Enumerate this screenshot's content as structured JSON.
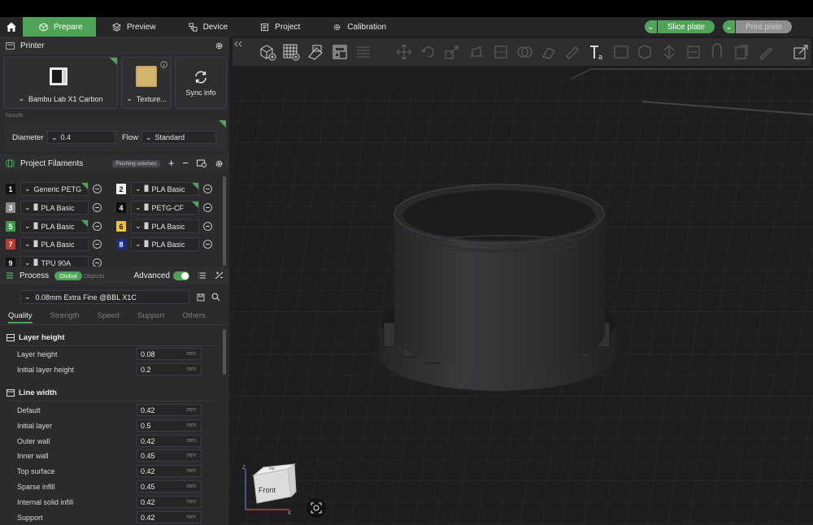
{
  "nav": {
    "tabs": [
      {
        "label": "Prepare"
      },
      {
        "label": "Preview"
      },
      {
        "label": "Device"
      },
      {
        "label": "Project"
      },
      {
        "label": "Calibration"
      }
    ],
    "slice_label": "Slice plate",
    "print_label": "Print plate"
  },
  "printer": {
    "section_title": "Printer",
    "name": "Bambu Lab X1 Carbon",
    "plate": "Texture...",
    "sync_label": "Sync info",
    "nozzle_title": "Nozzle",
    "diameter_label": "Diameter",
    "diameter_value": "0.4",
    "flow_label": "Flow",
    "flow_value": "Standard"
  },
  "filaments": {
    "section_title": "Project Filaments",
    "flushing_label": "Flushing volumes",
    "items": [
      {
        "num": "1",
        "name": "Generic PETG",
        "color": "#111111",
        "text": "#ffffff"
      },
      {
        "num": "2",
        "name": "PLA Basic",
        "color": "#f2f2f2",
        "text": "#111111"
      },
      {
        "num": "3",
        "name": "PLA Basic",
        "color": "#8a8a8a",
        "text": "#ffffff"
      },
      {
        "num": "4",
        "name": "PETG-CF",
        "color": "#0d0d0d",
        "text": "#ffffff"
      },
      {
        "num": "5",
        "name": "PLA Basic",
        "color": "#3c9b45",
        "text": "#ffffff"
      },
      {
        "num": "6",
        "name": "PLA Basic",
        "color": "#f1c232",
        "text": "#111111"
      },
      {
        "num": "7",
        "name": "PLA Basic",
        "color": "#c0392b",
        "text": "#ffffff"
      },
      {
        "num": "8",
        "name": "PLA Basic",
        "color": "#1c2f8a",
        "text": "#ffffff"
      },
      {
        "num": "9",
        "name": "TPU 90A",
        "color": "#111111",
        "text": "#ffffff"
      }
    ]
  },
  "process": {
    "section_title": "Process",
    "global_label": "Global",
    "objects_label": "Objects",
    "advanced_label": "Advanced",
    "preset": "0.08mm Extra Fine @BBL X1C",
    "tabs": [
      "Quality",
      "Strength",
      "Speed",
      "Support",
      "Others"
    ],
    "groups": [
      {
        "title": "Layer height",
        "rows": [
          {
            "label": "Layer height",
            "value": "0.08",
            "unit": "mm"
          },
          {
            "label": "Initial layer height",
            "value": "0.2",
            "unit": "mm"
          }
        ]
      },
      {
        "title": "Line width",
        "rows": [
          {
            "label": "Default",
            "value": "0.42",
            "unit": "mm"
          },
          {
            "label": "Initial layer",
            "value": "0.5",
            "unit": "mm"
          },
          {
            "label": "Outer wall",
            "value": "0.42",
            "unit": "mm"
          },
          {
            "label": "Inner wall",
            "value": "0.45",
            "unit": "mm"
          },
          {
            "label": "Top surface",
            "value": "0.42",
            "unit": "mm"
          },
          {
            "label": "Sparse infill",
            "value": "0.45",
            "unit": "mm"
          },
          {
            "label": "Internal solid infill",
            "value": "0.42",
            "unit": "mm"
          },
          {
            "label": "Support",
            "value": "0.42",
            "unit": "mm"
          }
        ]
      }
    ]
  },
  "viewport": {
    "cube_front_label": "Front",
    "cube_top_label": "Top",
    "axis_z": "Z",
    "axis_x": "X"
  },
  "colors": {
    "accent": "#4fa357",
    "panel": "#2b2b2d",
    "viewport_bg": "#1f1f21"
  }
}
